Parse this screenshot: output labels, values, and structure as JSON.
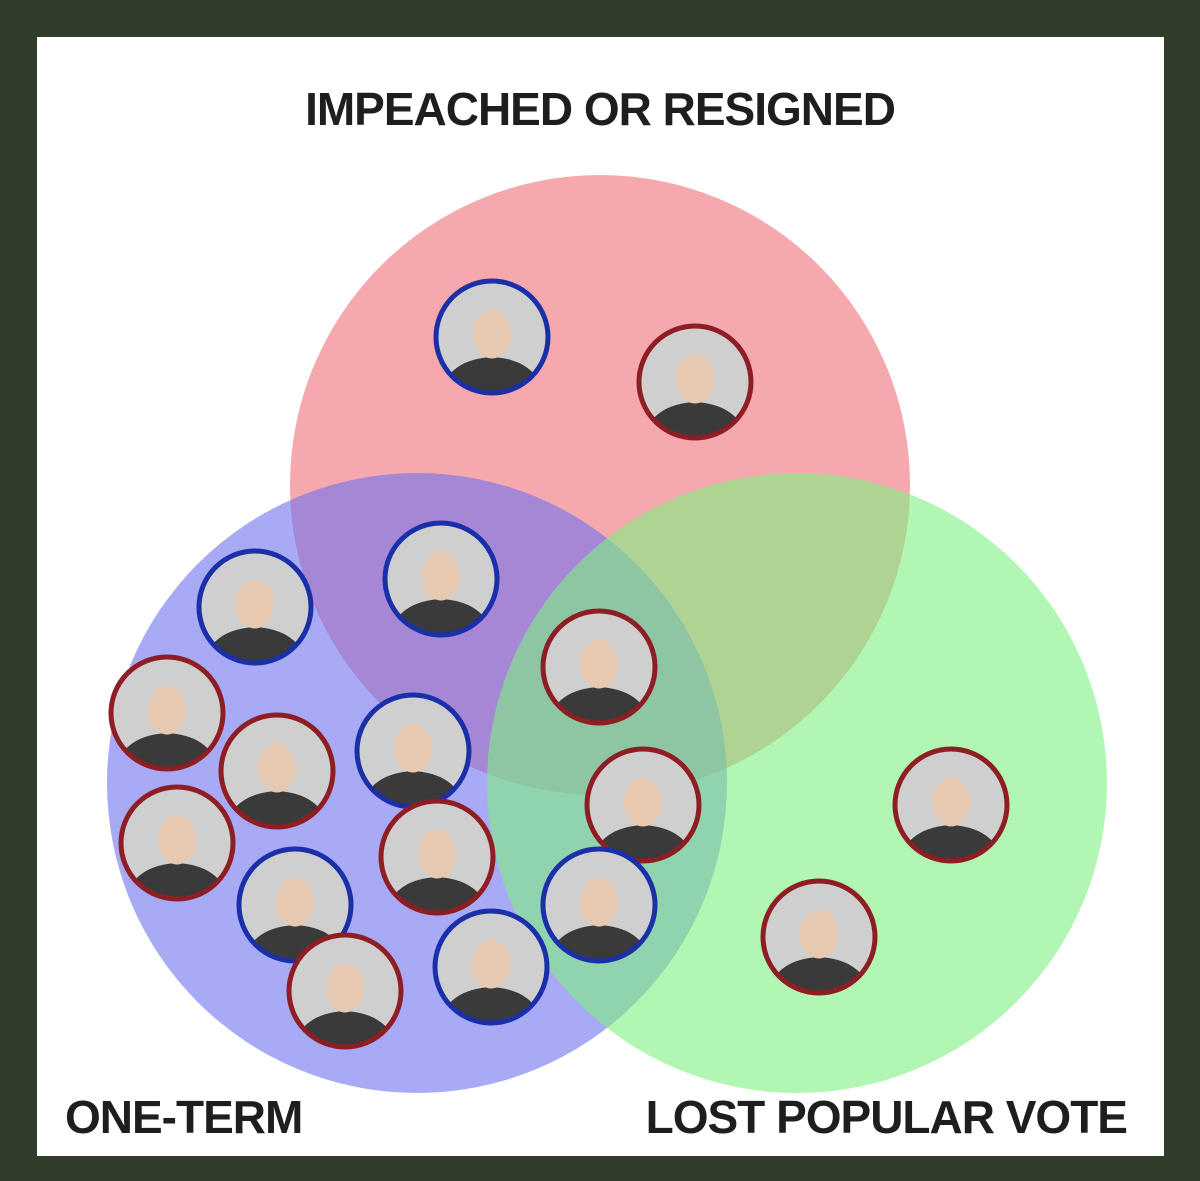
{
  "sets": [
    {
      "id": "impeached",
      "label": "IMPEACHED OR RESIGNED",
      "color": "#ef6f78"
    },
    {
      "id": "one_term",
      "label": "ONE-TERM",
      "color": "#6f72f0"
    },
    {
      "id": "lost_popular",
      "label": "LOST POPULAR VOTE",
      "color": "#7ff080"
    }
  ],
  "colors": {
    "background": "#2f3d2a",
    "canvas": "#ffffff",
    "ring_red": "#8f1d24",
    "ring_blue": "#1b2fa8",
    "portrait_bg": "#cfcfcf",
    "portrait_dark": "#3a3a3a"
  },
  "portraits": [
    {
      "id": "p1",
      "region": "impeached",
      "ring": "ring_blue",
      "icon": "portrait-icon"
    },
    {
      "id": "p2",
      "region": "impeached",
      "ring": "ring_red",
      "icon": "portrait-icon"
    },
    {
      "id": "p3",
      "region": "impeached+one_term",
      "ring": "ring_blue",
      "icon": "portrait-icon"
    },
    {
      "id": "p4",
      "region": "impeached+one_term+lost_popular",
      "ring": "ring_red",
      "icon": "portrait-icon"
    },
    {
      "id": "p5",
      "region": "one_term",
      "ring": "ring_blue",
      "icon": "portrait-icon"
    },
    {
      "id": "p6",
      "region": "one_term",
      "ring": "ring_red",
      "icon": "portrait-icon"
    },
    {
      "id": "p7",
      "region": "one_term",
      "ring": "ring_red",
      "icon": "portrait-icon"
    },
    {
      "id": "p8",
      "region": "one_term",
      "ring": "ring_blue",
      "icon": "portrait-icon"
    },
    {
      "id": "p9",
      "region": "one_term",
      "ring": "ring_red",
      "icon": "portrait-icon"
    },
    {
      "id": "p10",
      "region": "one_term",
      "ring": "ring_blue",
      "icon": "portrait-icon"
    },
    {
      "id": "p11",
      "region": "one_term",
      "ring": "ring_red",
      "icon": "portrait-icon"
    },
    {
      "id": "p12",
      "region": "one_term",
      "ring": "ring_red",
      "icon": "portrait-icon"
    },
    {
      "id": "p13",
      "region": "one_term",
      "ring": "ring_blue",
      "icon": "portrait-icon"
    },
    {
      "id": "p14",
      "region": "one_term+lost_popular",
      "ring": "ring_red",
      "icon": "portrait-icon"
    },
    {
      "id": "p15",
      "region": "one_term+lost_popular",
      "ring": "ring_blue",
      "icon": "portrait-icon"
    },
    {
      "id": "p16",
      "region": "lost_popular",
      "ring": "ring_red",
      "icon": "portrait-icon"
    },
    {
      "id": "p17",
      "region": "lost_popular",
      "ring": "ring_red",
      "icon": "portrait-icon"
    }
  ]
}
